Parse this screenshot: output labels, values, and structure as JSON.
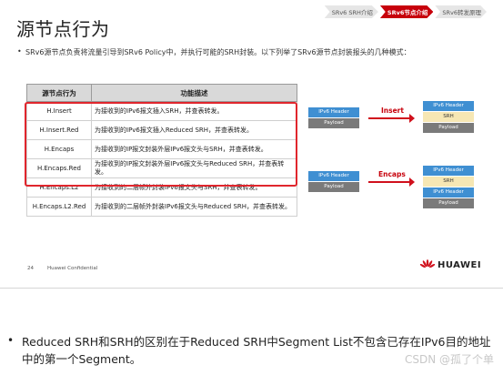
{
  "slide": {
    "title": "源节点行为",
    "nav_tabs": [
      "SRv6 SRH介绍",
      "SRv6节点介绍",
      "SRv6转发原理"
    ],
    "bullet": "SRv6源节点负责将流量引导到SRv6 Policy中，并执行可能的SRH封装。以下列举了SRv6源节点封装报头的几种模式：",
    "table": {
      "headers": [
        "源节点行为",
        "功能描述"
      ],
      "rows": [
        {
          "behavior": "H.Insert",
          "desc": "为接收到的IPv6报文插入SRH，并查表转发。"
        },
        {
          "behavior": "H.Insert.Red",
          "desc": "为接收到的IPv6报文插入Reduced SRH，并查表转发。"
        },
        {
          "behavior": "H.Encaps",
          "desc": "为接收到的IP报文封装外层IPv6报文头与SRH，并查表转发。"
        },
        {
          "behavior": "H.Encaps.Red",
          "desc": "为接收到的IP报文封装外层IPv6报文头与Reduced SRH，并查表转发。"
        },
        {
          "behavior": "H.Encaps.L2",
          "desc": "为接收到的二层帧外封装IPv6报文头与SRH，并查表转发。"
        },
        {
          "behavior": "H.Encaps.L2.Red",
          "desc": "为接收到的二层帧外封装IPv6报文头与Reduced SRH，并查表转发。"
        }
      ]
    },
    "diagram": {
      "insert": {
        "label": "Insert",
        "before": [
          "IPv6 Header",
          "Payload"
        ],
        "after": [
          "IPv6 Header",
          "SRH",
          "Payload"
        ]
      },
      "encaps": {
        "label": "Encaps",
        "before": [
          "IPv6 Header",
          "Payload"
        ],
        "after": [
          "IPv6 Header",
          "SRH",
          "IPv6 Header",
          "Payload"
        ]
      }
    },
    "footer": {
      "page": "24",
      "confidential": "Huawei Confidential",
      "logo": "HUAWEI"
    }
  },
  "note": "Reduced SRH和SRH的区别在于Reduced SRH中Segment List不包含已存在IPv6目的地址中的第一个Segment。",
  "watermark": "CSDN @孤了个单",
  "colors": {
    "accent": "#c7000b",
    "ipv6": "#3f8fd2",
    "payload": "#7a7a7a",
    "srh": "#f6e7b4",
    "highlight": "#e0262d"
  }
}
